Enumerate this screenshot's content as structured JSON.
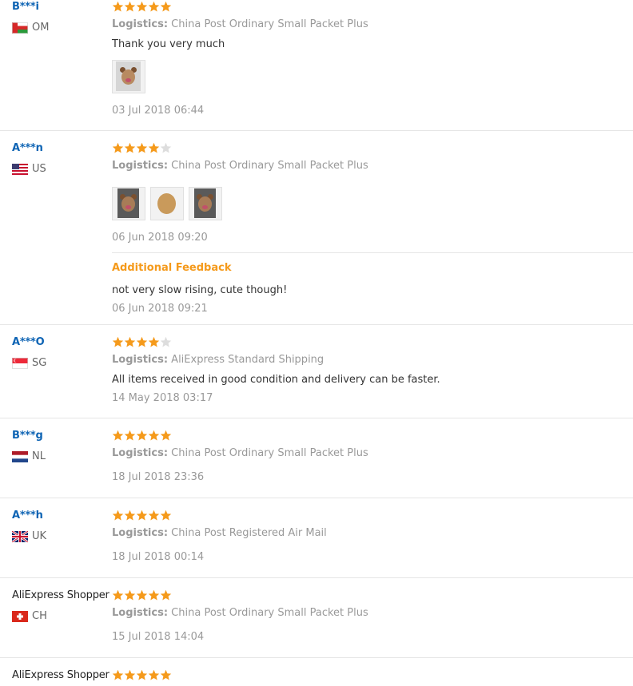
{
  "colors": {
    "star_filled": "#f59a1b",
    "star_empty": "#dddddd",
    "username": "#0e64b4",
    "muted": "#999999",
    "additional_feedback": "#f59a1b"
  },
  "reviews": [
    {
      "user": "B***i",
      "country": "OM",
      "flag": "oman-flag-icon",
      "stars": 5,
      "logistics_label": "Logistics:",
      "logistics": "China Post Ordinary Small Packet Plus",
      "text": "Thank you very much",
      "photos": 1,
      "date": "03 Jul 2018 06:44"
    },
    {
      "user": "A***n",
      "country": "US",
      "flag": "usa-flag-icon",
      "stars": 4,
      "logistics_label": "Logistics:",
      "logistics": "China Post Ordinary Small Packet Plus",
      "photos": 3,
      "date": "06 Jun 2018 09:20",
      "additional_feedback_label": "Additional Feedback",
      "additional_text": "not very slow rising, cute though!",
      "additional_date": "06 Jun 2018 09:21"
    },
    {
      "user": "A***O",
      "country": "SG",
      "flag": "singapore-flag-icon",
      "stars": 4,
      "logistics_label": "Logistics:",
      "logistics": "AliExpress Standard Shipping",
      "text": "All items received in good condition and delivery can be faster.",
      "date": "14 May 2018 03:17"
    },
    {
      "user": "B***g",
      "country": "NL",
      "flag": "netherlands-flag-icon",
      "stars": 5,
      "logistics_label": "Logistics:",
      "logistics": "China Post Ordinary Small Packet Plus",
      "date": "18 Jul 2018 23:36"
    },
    {
      "user": "A***h",
      "country": "UK",
      "flag": "uk-flag-icon",
      "stars": 5,
      "logistics_label": "Logistics:",
      "logistics": "China Post Registered Air Mail",
      "date": "18 Jul 2018 00:14"
    },
    {
      "user": "AliExpress Shopper",
      "country": "CH",
      "flag": "switzerland-flag-icon",
      "stars": 5,
      "logistics_label": "Logistics:",
      "logistics": "China Post Ordinary Small Packet Plus",
      "date": "15 Jul 2018 14:04"
    },
    {
      "user": "AliExpress Shopper",
      "stars": 5
    }
  ]
}
